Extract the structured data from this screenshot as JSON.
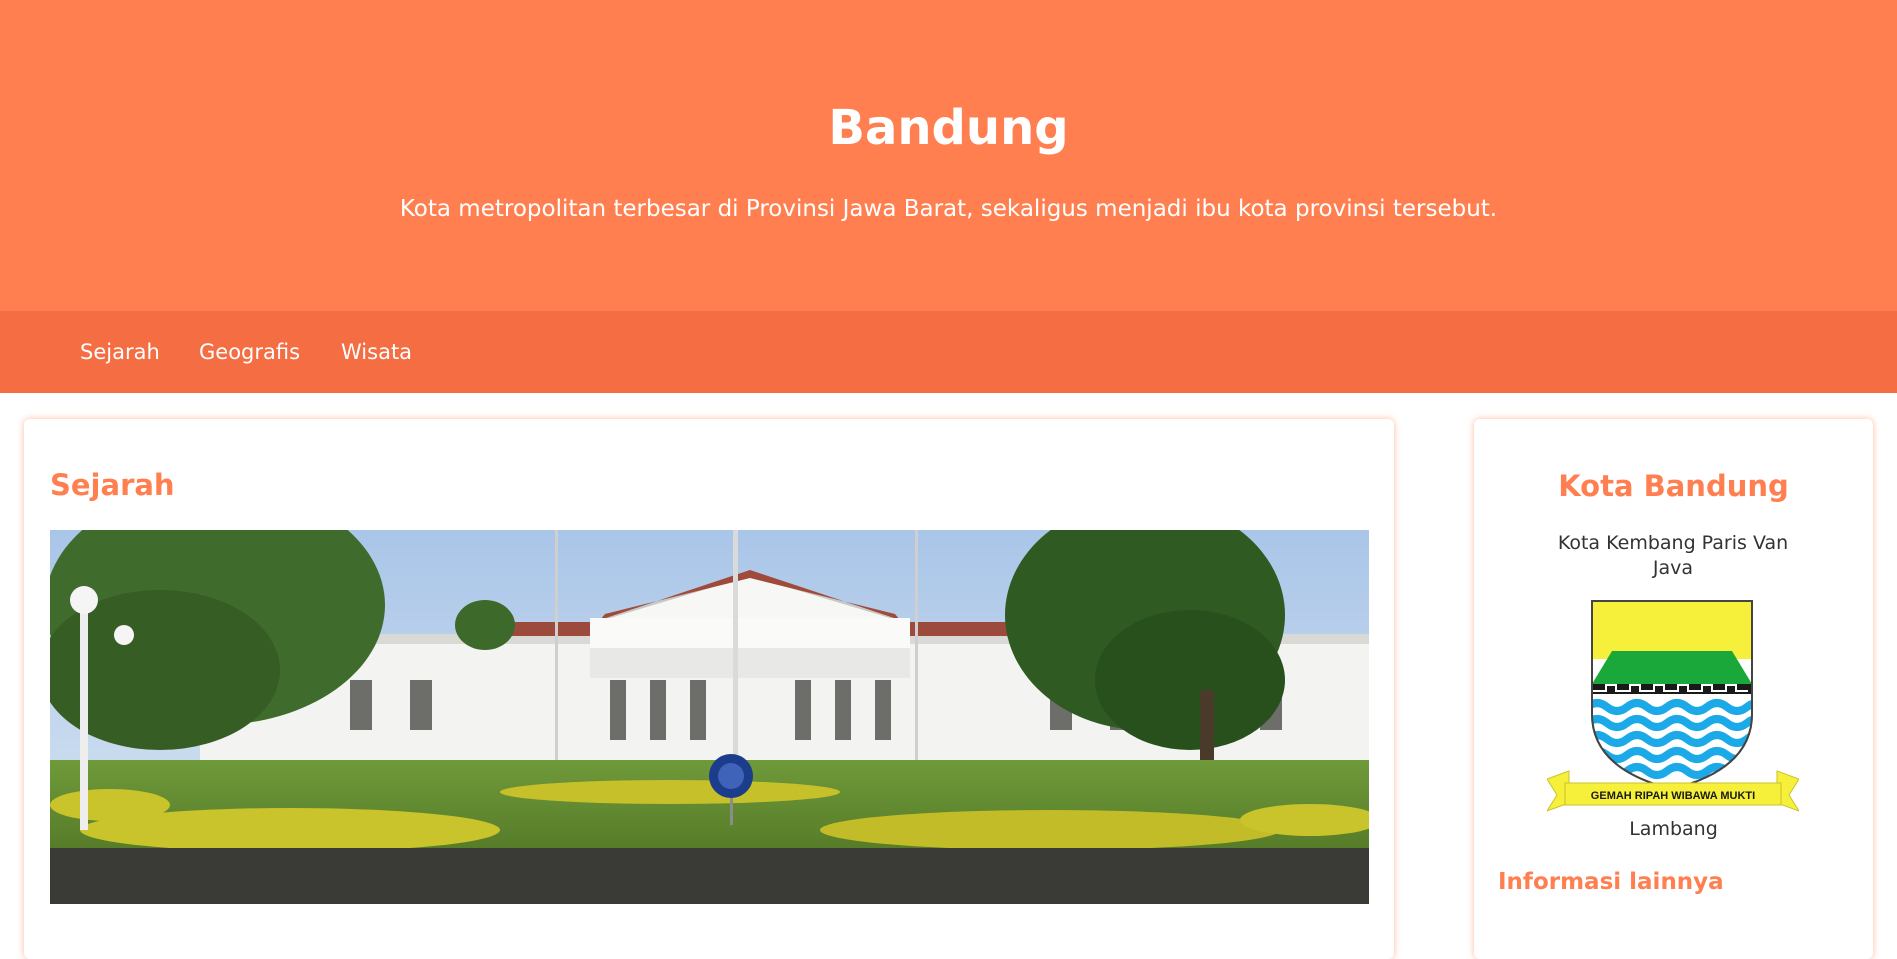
{
  "header": {
    "title": "Bandung",
    "subtitle": "Kota metropolitan terbesar di Provinsi Jawa Barat, sekaligus menjadi ibu kota provinsi tersebut."
  },
  "nav": {
    "items": [
      {
        "label": "Sejarah"
      },
      {
        "label": "Geografis"
      },
      {
        "label": "Wisata"
      }
    ]
  },
  "main": {
    "section_title": "Sejarah"
  },
  "aside": {
    "title": "Kota Bandung",
    "tagline": "Kota Kembang Paris Van Java",
    "emblem_motto": "GEMAH RIPAH WIBAWA MUKTI",
    "emblem_caption": "Lambang",
    "more_info_heading": "Informasi lainnya"
  },
  "colors": {
    "header_bg": "#ff7f50",
    "nav_bg": "#f46d43",
    "accent": "#ff7f50",
    "card_shadow": "#ffb79c"
  },
  "icons": {
    "photo": "gedung-sate-photo",
    "emblem": "bandung-coat-of-arms"
  }
}
